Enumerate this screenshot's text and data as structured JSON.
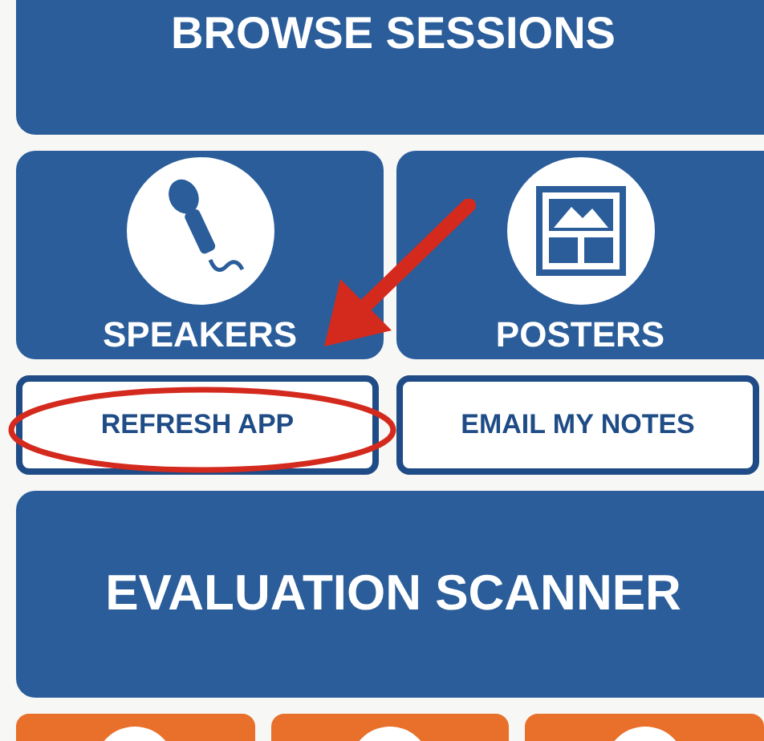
{
  "header_button": {
    "label": "BROWSE SESSIONS"
  },
  "tiles": [
    {
      "label": "SPEAKERS",
      "kind": "microphone"
    },
    {
      "label": "POSTERS",
      "kind": "gallery"
    }
  ],
  "small_buttons": [
    {
      "label": "REFRESH APP",
      "circled": true
    },
    {
      "label": "EMAIL MY NOTES",
      "circled": false
    }
  ],
  "annotations": {
    "arrow": true
  },
  "main_button": {
    "label": "EVALUATION SCANNER"
  },
  "bottom_tiles": [
    {
      "kind": "orange_tile"
    },
    {
      "kind": "orange_tile"
    },
    {
      "kind": "orange_tile"
    }
  ]
}
